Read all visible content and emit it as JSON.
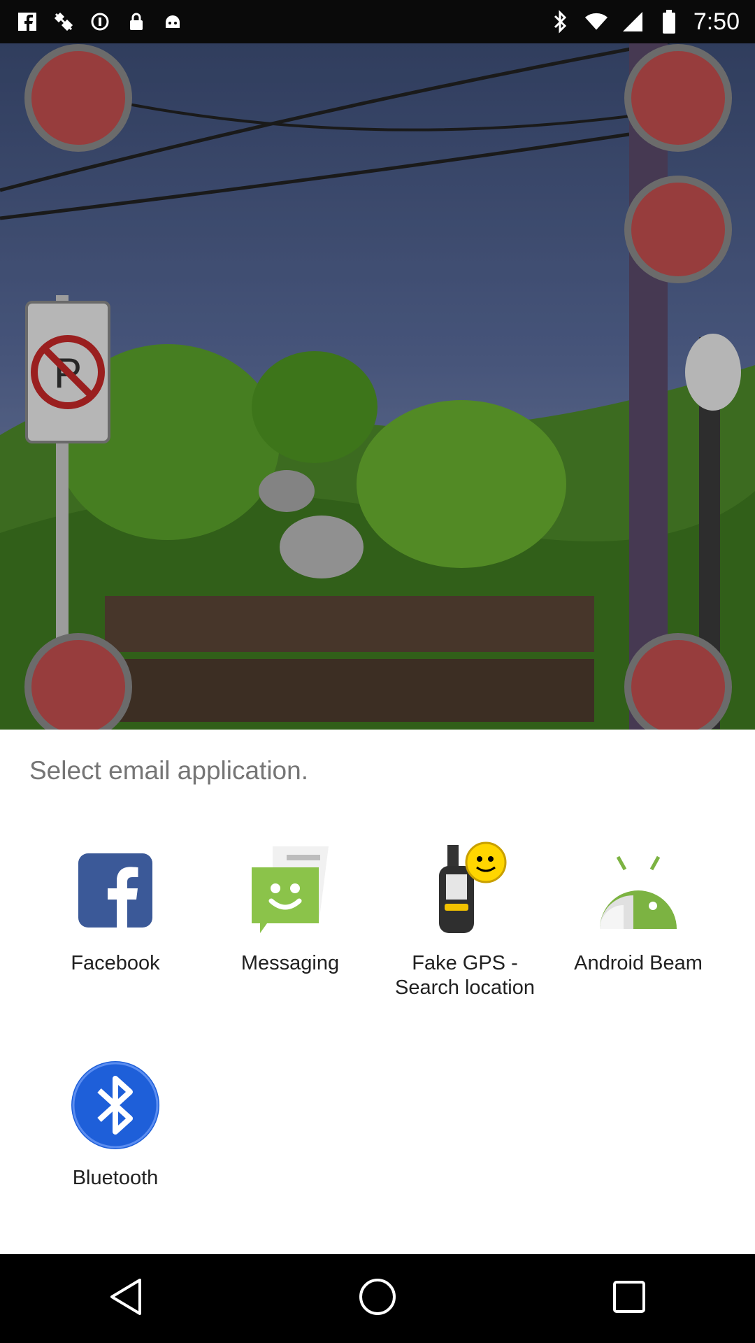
{
  "status_bar": {
    "time": "7:50",
    "left_icons": [
      "facebook-notification-icon",
      "fake-gps-icon",
      "data-saver-icon",
      "lock-icon",
      "android-icon"
    ],
    "right_icons": [
      "bluetooth-icon",
      "wifi-icon",
      "signal-icon",
      "battery-icon"
    ]
  },
  "dialog": {
    "title": "Select email application.",
    "apps": [
      {
        "label": "Facebook",
        "icon": "facebook-icon"
      },
      {
        "label": "Messaging",
        "icon": "messaging-icon"
      },
      {
        "label": "Fake GPS - Search location",
        "icon": "fake-gps-icon"
      },
      {
        "label": "Android Beam",
        "icon": "android-beam-icon"
      },
      {
        "label": "Bluetooth",
        "icon": "bluetooth-icon"
      }
    ]
  },
  "nav": {
    "back": "back-icon",
    "home": "home-icon",
    "recents": "recents-icon"
  },
  "colors": {
    "facebook": "#3b5998",
    "messaging": "#8bc34a",
    "bluetooth": "#1e5fd9",
    "android": "#7cb342"
  }
}
